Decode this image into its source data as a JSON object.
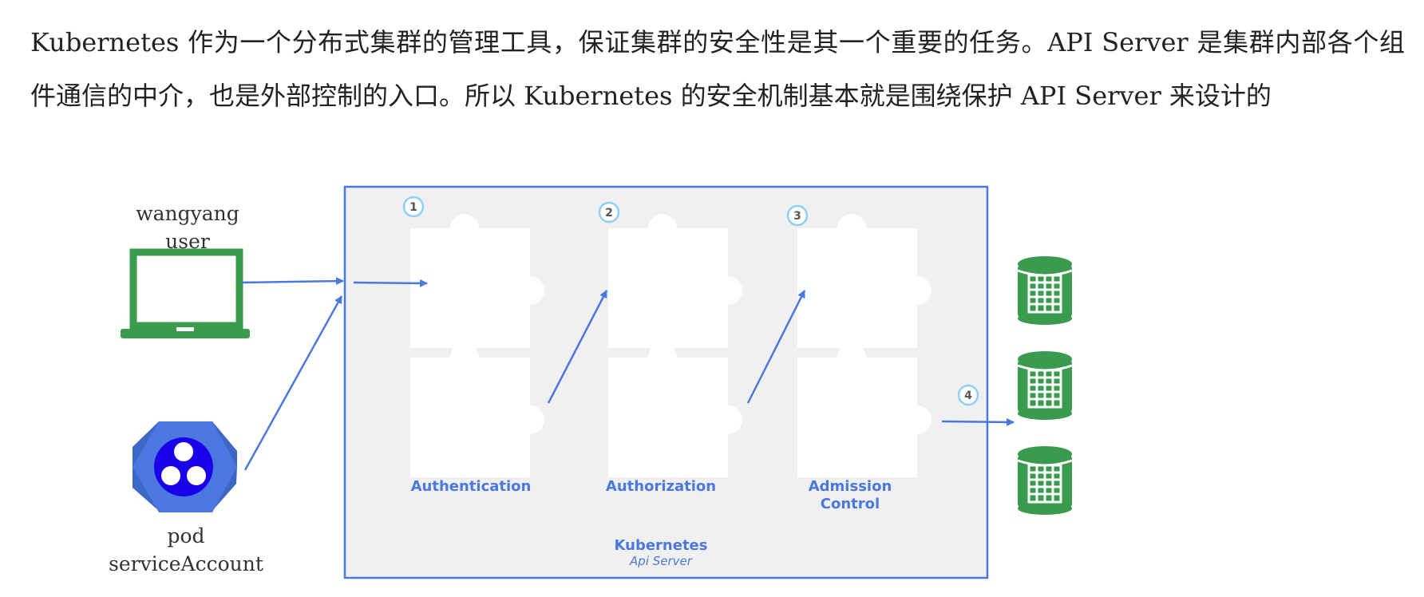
{
  "intro_text": "Kubernetes 作为一个分布式集群的管理工具，保证集群的安全性是其一个重要的任务。API Server 是集群内部各个组件通信的中介，也是外部控制的入口。所以 Kubernetes 的安全机制基本就是围绕保护 API Server 来设计的",
  "user": {
    "line1": "wangyang",
    "line2": "user",
    "icon": "laptop-icon"
  },
  "pod": {
    "line1": "pod",
    "line2": "serviceAccount",
    "icon": "pod-hexagon-icon"
  },
  "steps": [
    {
      "number": "1",
      "label": "Authentication"
    },
    {
      "number": "2",
      "label": "Authorization"
    },
    {
      "number": "3",
      "label_line1": "Admission",
      "label_line2": "Control"
    },
    {
      "number": "4"
    }
  ],
  "api_server": {
    "title": "Kubernetes",
    "subtitle": "Api Server"
  },
  "storage": {
    "icon": "database-icon",
    "count": 3
  },
  "colors": {
    "arrow": "#4a78e0",
    "box_border": "#4a78e0",
    "box_fill": "#f0f0f0",
    "green": "#3a9a4e",
    "pod_hex": "#4a78e0",
    "pod_core": "#1a00e8",
    "number_ring": "#8ed0f5"
  }
}
